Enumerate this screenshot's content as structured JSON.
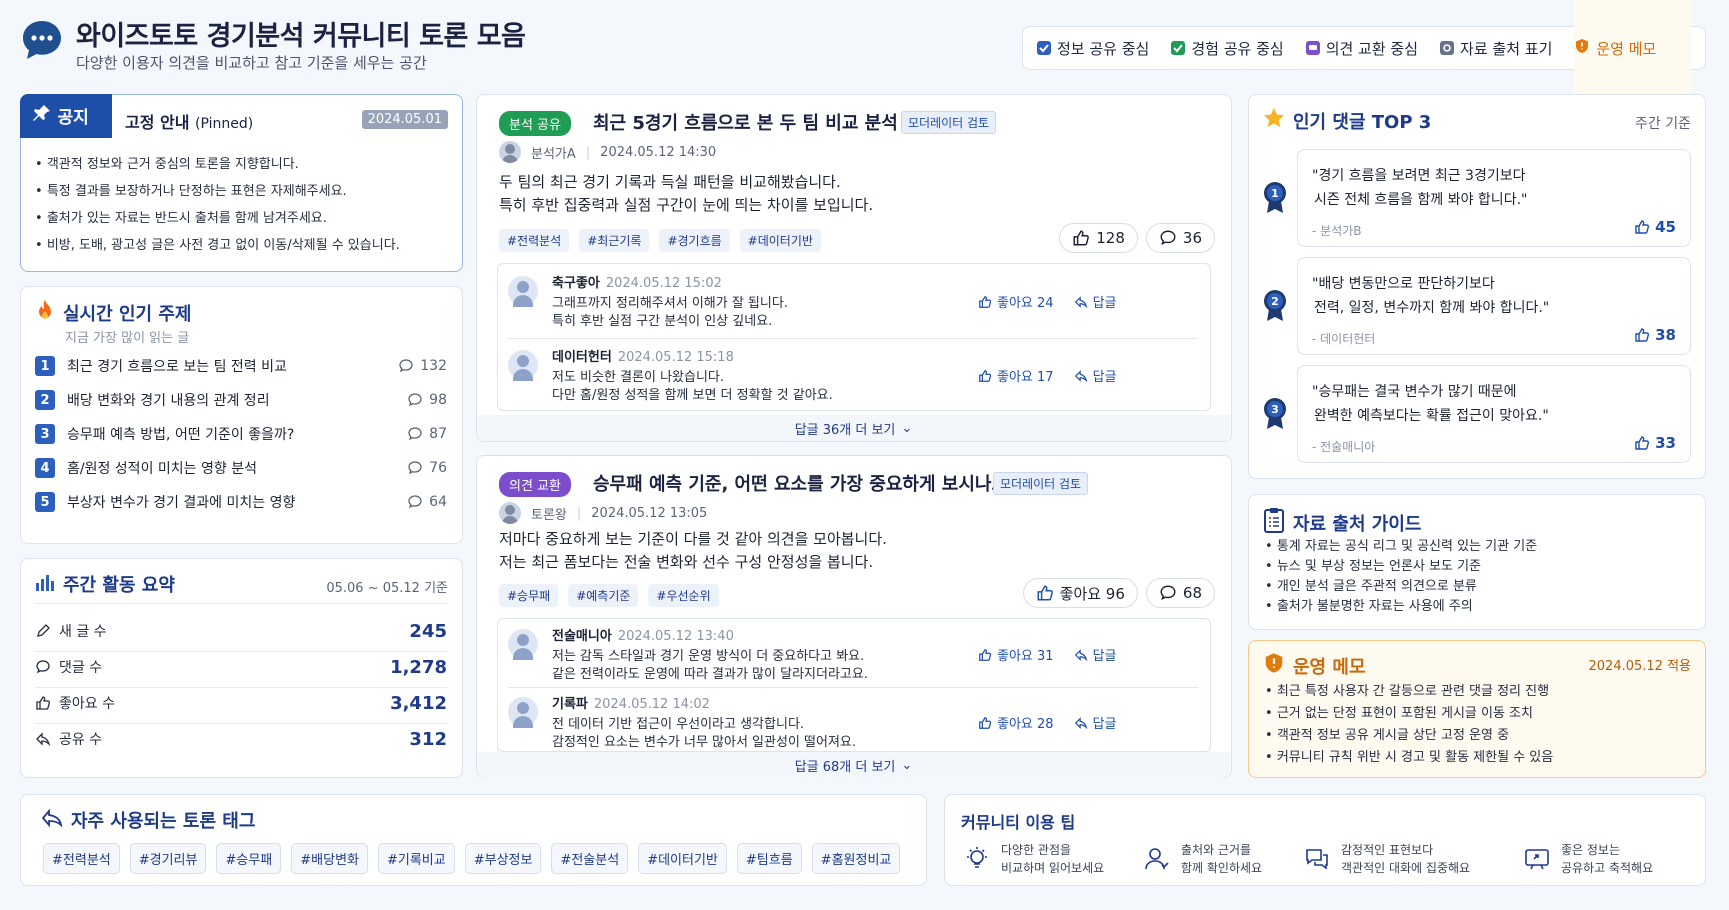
{
  "header": {
    "title": "와이즈토토 경기분석 커뮤니티 토론 모음",
    "subtitle": "다양한 이용자 의견을 비교하고 참고 기준을 세우는 공간",
    "legend": [
      {
        "label": "정보 공유 중심",
        "color": "#2d5fbf",
        "icon": "check-square-icon"
      },
      {
        "label": "경험 공유 중심",
        "color": "#1f9d55",
        "icon": "check-square-icon"
      },
      {
        "label": "의견 교환 중심",
        "color": "#7c4dcc",
        "icon": "chat-square-icon"
      },
      {
        "label": "자료 출처 표기",
        "color": "#64748b",
        "icon": "link-square-icon"
      },
      {
        "label": "운영 메모",
        "color": "#e07b0c",
        "icon": "warning-shield-icon"
      }
    ]
  },
  "notice": {
    "tab": "공지",
    "title": "고정 안내",
    "title_suffix": "(Pinned)",
    "date": "2024.05.01",
    "items": [
      "객관적 정보와 근거 중심의 토론을 지향합니다.",
      "특정 결과를 보장하거나 단정하는 표현은 자제해주세요.",
      "출처가 있는 자료는 반드시 출처를 함께 남겨주세요.",
      "비방, 도배, 광고성 글은 사전 경고 없이 이동/삭제될 수 있습니다."
    ]
  },
  "hot": {
    "title": "실시간 인기 주제",
    "subtitle": "지금 가장 많이 읽는 글",
    "items": [
      {
        "rank": "1",
        "label": "최근 경기 흐름으로 보는 팀 전력 비교",
        "count": "132"
      },
      {
        "rank": "2",
        "label": "배당 변화와 경기 내용의 관계 정리",
        "count": "98"
      },
      {
        "rank": "3",
        "label": "승무패 예측 방법, 어떤 기준이 좋을까?",
        "count": "87"
      },
      {
        "rank": "4",
        "label": "홈/원정 성적이 미치는 영향 분석",
        "count": "76"
      },
      {
        "rank": "5",
        "label": "부상자 변수가 경기 결과에 미치는 영향",
        "count": "64"
      }
    ]
  },
  "weekly": {
    "title": "주간 활동 요약",
    "range": "05.06 ~ 05.12 기준",
    "stats": [
      {
        "label": "새 글 수",
        "value": "245",
        "icon": "pencil-icon"
      },
      {
        "label": "댓글 수",
        "value": "1,278",
        "icon": "comment-icon"
      },
      {
        "label": "좋아요 수",
        "value": "3,412",
        "icon": "thumbs-up-icon"
      },
      {
        "label": "공유 수",
        "value": "312",
        "icon": "share-icon"
      }
    ]
  },
  "post1": {
    "badge": "분석 공유",
    "badge_color": "#1f9d55",
    "title": "최근 5경기 흐름으로 본 두 팀 비교 분석",
    "mod": "모더레이터 검토",
    "author": "분석가A",
    "time": "2024.05.12 14:30",
    "body1": "두 팀의 최근 경기 기록과 득실 패턴을 비교해봤습니다.",
    "body2": "특히 후반 집중력과 실점 구간이 눈에 띄는 차이를 보입니다.",
    "tags": [
      "#전력분석",
      "#최근기록",
      "#경기흐름",
      "#데이터기반"
    ],
    "likes": "128",
    "comments": "36",
    "replies": [
      {
        "name": "축구좋아",
        "time": "2024.05.12 15:02",
        "l1": "그래프까지 정리해주셔서 이해가 잘 됩니다.",
        "l2": "특히 후반 실점 구간 분석이 인상 깊네요.",
        "like": "좋아요 24",
        "reply": "답글"
      },
      {
        "name": "데이터헌터",
        "time": "2024.05.12 15:18",
        "l1": "저도 비슷한 결론이 나왔습니다.",
        "l2": "다만 홈/원정 성적을 함께 보면 더 정확할 것 같아요.",
        "like": "좋아요 17",
        "reply": "답글"
      }
    ],
    "more": "답글 36개 더 보기"
  },
  "post2": {
    "badge": "의견 교환",
    "badge_color": "#7c4dcc",
    "title": "승무패 예측 기준, 어떤 요소를 가장 중요하게 보시나요?",
    "mod": "모더레이터 검토",
    "author": "토론왕",
    "time": "2024.05.12 13:05",
    "body1": "저마다 중요하게 보는 기준이 다를 것 같아 의견을 모아봅니다.",
    "body2": "저는 최근 폼보다는 전술 변화와 선수 구성 안정성을 봅니다.",
    "tags": [
      "#승무패",
      "#예측기준",
      "#우선순위"
    ],
    "likes": "좋아요 96",
    "comments": "68",
    "replies": [
      {
        "name": "전술매니아",
        "time": "2024.05.12 13:40",
        "l1": "저는 감독 스타일과 경기 운영 방식이 더 중요하다고 봐요.",
        "l2": "같은 전력이라도 운영에 따라 결과가 많이 달라지더라고요.",
        "like": "좋아요 31",
        "reply": "답글"
      },
      {
        "name": "기록파",
        "time": "2024.05.12 14:02",
        "l1": "전 데이터 기반 접근이 우선이라고 생각합니다.",
        "l2": "감정적인 요소는 변수가 너무 많아서 일관성이 떨어져요.",
        "like": "좋아요 28",
        "reply": "답글"
      }
    ],
    "more": "답글 68개 더 보기"
  },
  "top3": {
    "title": "인기 댓글 TOP 3",
    "basis": "주간 기준",
    "items": [
      {
        "rank": "1",
        "q1": "\"경기 흐름을 보려면 최근 3경기보다",
        "q2": "시즌 전체 흐름을 함께 봐야 합니다.\"",
        "author": "- 분석가B",
        "likes": "45"
      },
      {
        "rank": "2",
        "q1": "\"배당 변동만으로 판단하기보다",
        "q2": "전력, 일정, 변수까지 함께 봐야 합니다.\"",
        "author": "- 데이터헌터",
        "likes": "38"
      },
      {
        "rank": "3",
        "q1": "\"승무패는 결국 변수가 많기 때문에",
        "q2": "완벽한 예측보다는 확률 접근이 맞아요.\"",
        "author": "- 전술매니아",
        "likes": "33"
      }
    ]
  },
  "guide": {
    "title": "자료 출처 가이드",
    "items": [
      "통계 자료는 공식 리그 및 공신력 있는 기관 기준",
      "뉴스 및 부상 정보는 언론사 보도 기준",
      "개인 분석 글은 주관적 의견으로 분류",
      "출처가 불분명한 자료는 사용에 주의"
    ]
  },
  "memo": {
    "title": "운영 메모",
    "date": "2024.05.12 적용",
    "items": [
      "최근 특정 사용자 간 갈등으로 관련 댓글 정리 진행",
      "근거 없는 단정 표현이 포함된 게시글 이동 조치",
      "객관적 정보 공유 게시글 상단 고정 운영 중",
      "커뮤니티 규칙 위반 시 경고 및 활동 제한될 수 있음"
    ]
  },
  "tagsbar": {
    "title": "자주 사용되는 토론 태그",
    "tags": [
      "#전력분석",
      "#경기리뷰",
      "#승무패",
      "#배당변화",
      "#기록비교",
      "#부상정보",
      "#전술분석",
      "#데이터기반",
      "#팀흐름",
      "#홈원정비교"
    ]
  },
  "tips": {
    "title": "커뮤니티 이용 팁",
    "items": [
      {
        "l1": "다양한 관점을",
        "l2": "비교하며 읽어보세요",
        "icon": "lightbulb-icon"
      },
      {
        "l1": "출처와 근거를",
        "l2": "함께 확인하세요",
        "icon": "user-check-icon"
      },
      {
        "l1": "감정적인 표현보다",
        "l2": "객관적인 대화에 집중해요",
        "icon": "chat-bubbles-icon"
      },
      {
        "l1": "좋은 정보는",
        "l2": "공유하고 축적해요",
        "icon": "share-board-icon"
      }
    ]
  }
}
